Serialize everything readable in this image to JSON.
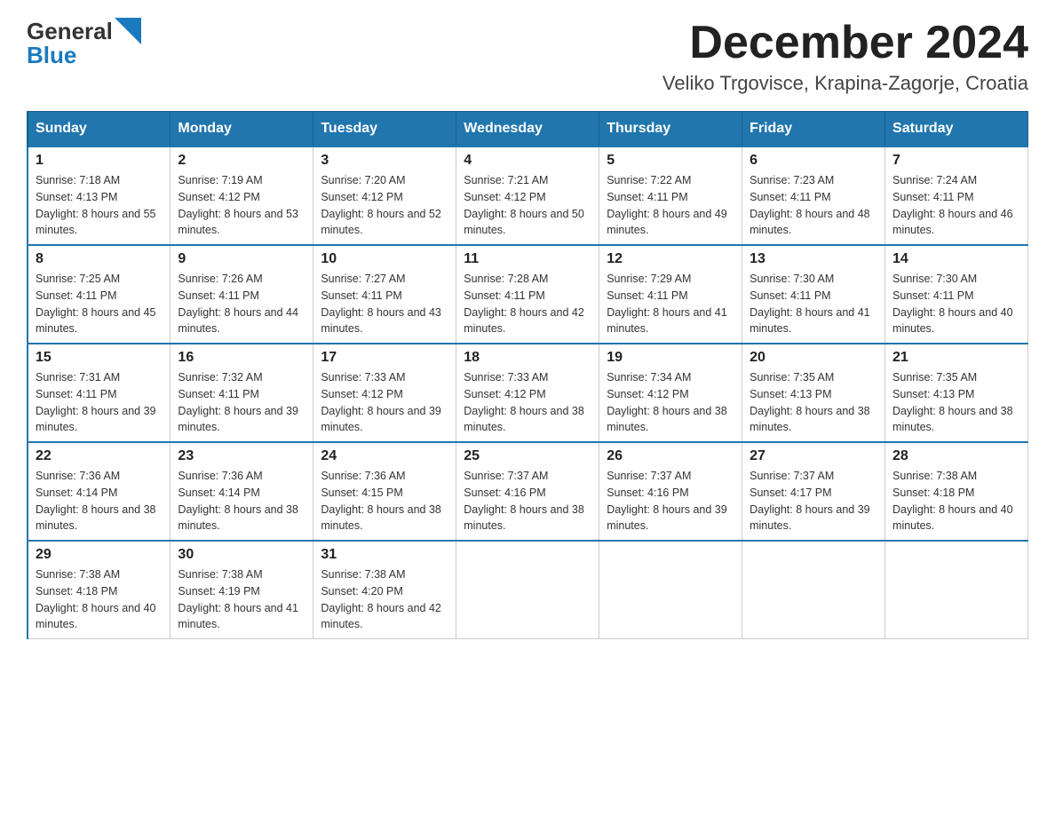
{
  "logo": {
    "general": "General",
    "blue": "Blue",
    "arrow_color": "#1a7abf"
  },
  "title": "December 2024",
  "location": "Veliko Trgovisce, Krapina-Zagorje, Croatia",
  "days_of_week": [
    "Sunday",
    "Monday",
    "Tuesday",
    "Wednesday",
    "Thursday",
    "Friday",
    "Saturday"
  ],
  "weeks": [
    [
      {
        "date": "1",
        "sunrise": "7:18 AM",
        "sunset": "4:13 PM",
        "daylight": "8 hours and 55 minutes."
      },
      {
        "date": "2",
        "sunrise": "7:19 AM",
        "sunset": "4:12 PM",
        "daylight": "8 hours and 53 minutes."
      },
      {
        "date": "3",
        "sunrise": "7:20 AM",
        "sunset": "4:12 PM",
        "daylight": "8 hours and 52 minutes."
      },
      {
        "date": "4",
        "sunrise": "7:21 AM",
        "sunset": "4:12 PM",
        "daylight": "8 hours and 50 minutes."
      },
      {
        "date": "5",
        "sunrise": "7:22 AM",
        "sunset": "4:11 PM",
        "daylight": "8 hours and 49 minutes."
      },
      {
        "date": "6",
        "sunrise": "7:23 AM",
        "sunset": "4:11 PM",
        "daylight": "8 hours and 48 minutes."
      },
      {
        "date": "7",
        "sunrise": "7:24 AM",
        "sunset": "4:11 PM",
        "daylight": "8 hours and 46 minutes."
      }
    ],
    [
      {
        "date": "8",
        "sunrise": "7:25 AM",
        "sunset": "4:11 PM",
        "daylight": "8 hours and 45 minutes."
      },
      {
        "date": "9",
        "sunrise": "7:26 AM",
        "sunset": "4:11 PM",
        "daylight": "8 hours and 44 minutes."
      },
      {
        "date": "10",
        "sunrise": "7:27 AM",
        "sunset": "4:11 PM",
        "daylight": "8 hours and 43 minutes."
      },
      {
        "date": "11",
        "sunrise": "7:28 AM",
        "sunset": "4:11 PM",
        "daylight": "8 hours and 42 minutes."
      },
      {
        "date": "12",
        "sunrise": "7:29 AM",
        "sunset": "4:11 PM",
        "daylight": "8 hours and 41 minutes."
      },
      {
        "date": "13",
        "sunrise": "7:30 AM",
        "sunset": "4:11 PM",
        "daylight": "8 hours and 41 minutes."
      },
      {
        "date": "14",
        "sunrise": "7:30 AM",
        "sunset": "4:11 PM",
        "daylight": "8 hours and 40 minutes."
      }
    ],
    [
      {
        "date": "15",
        "sunrise": "7:31 AM",
        "sunset": "4:11 PM",
        "daylight": "8 hours and 39 minutes."
      },
      {
        "date": "16",
        "sunrise": "7:32 AM",
        "sunset": "4:11 PM",
        "daylight": "8 hours and 39 minutes."
      },
      {
        "date": "17",
        "sunrise": "7:33 AM",
        "sunset": "4:12 PM",
        "daylight": "8 hours and 39 minutes."
      },
      {
        "date": "18",
        "sunrise": "7:33 AM",
        "sunset": "4:12 PM",
        "daylight": "8 hours and 38 minutes."
      },
      {
        "date": "19",
        "sunrise": "7:34 AM",
        "sunset": "4:12 PM",
        "daylight": "8 hours and 38 minutes."
      },
      {
        "date": "20",
        "sunrise": "7:35 AM",
        "sunset": "4:13 PM",
        "daylight": "8 hours and 38 minutes."
      },
      {
        "date": "21",
        "sunrise": "7:35 AM",
        "sunset": "4:13 PM",
        "daylight": "8 hours and 38 minutes."
      }
    ],
    [
      {
        "date": "22",
        "sunrise": "7:36 AM",
        "sunset": "4:14 PM",
        "daylight": "8 hours and 38 minutes."
      },
      {
        "date": "23",
        "sunrise": "7:36 AM",
        "sunset": "4:14 PM",
        "daylight": "8 hours and 38 minutes."
      },
      {
        "date": "24",
        "sunrise": "7:36 AM",
        "sunset": "4:15 PM",
        "daylight": "8 hours and 38 minutes."
      },
      {
        "date": "25",
        "sunrise": "7:37 AM",
        "sunset": "4:16 PM",
        "daylight": "8 hours and 38 minutes."
      },
      {
        "date": "26",
        "sunrise": "7:37 AM",
        "sunset": "4:16 PM",
        "daylight": "8 hours and 39 minutes."
      },
      {
        "date": "27",
        "sunrise": "7:37 AM",
        "sunset": "4:17 PM",
        "daylight": "8 hours and 39 minutes."
      },
      {
        "date": "28",
        "sunrise": "7:38 AM",
        "sunset": "4:18 PM",
        "daylight": "8 hours and 40 minutes."
      }
    ],
    [
      {
        "date": "29",
        "sunrise": "7:38 AM",
        "sunset": "4:18 PM",
        "daylight": "8 hours and 40 minutes."
      },
      {
        "date": "30",
        "sunrise": "7:38 AM",
        "sunset": "4:19 PM",
        "daylight": "8 hours and 41 minutes."
      },
      {
        "date": "31",
        "sunrise": "7:38 AM",
        "sunset": "4:20 PM",
        "daylight": "8 hours and 42 minutes."
      },
      null,
      null,
      null,
      null
    ]
  ]
}
